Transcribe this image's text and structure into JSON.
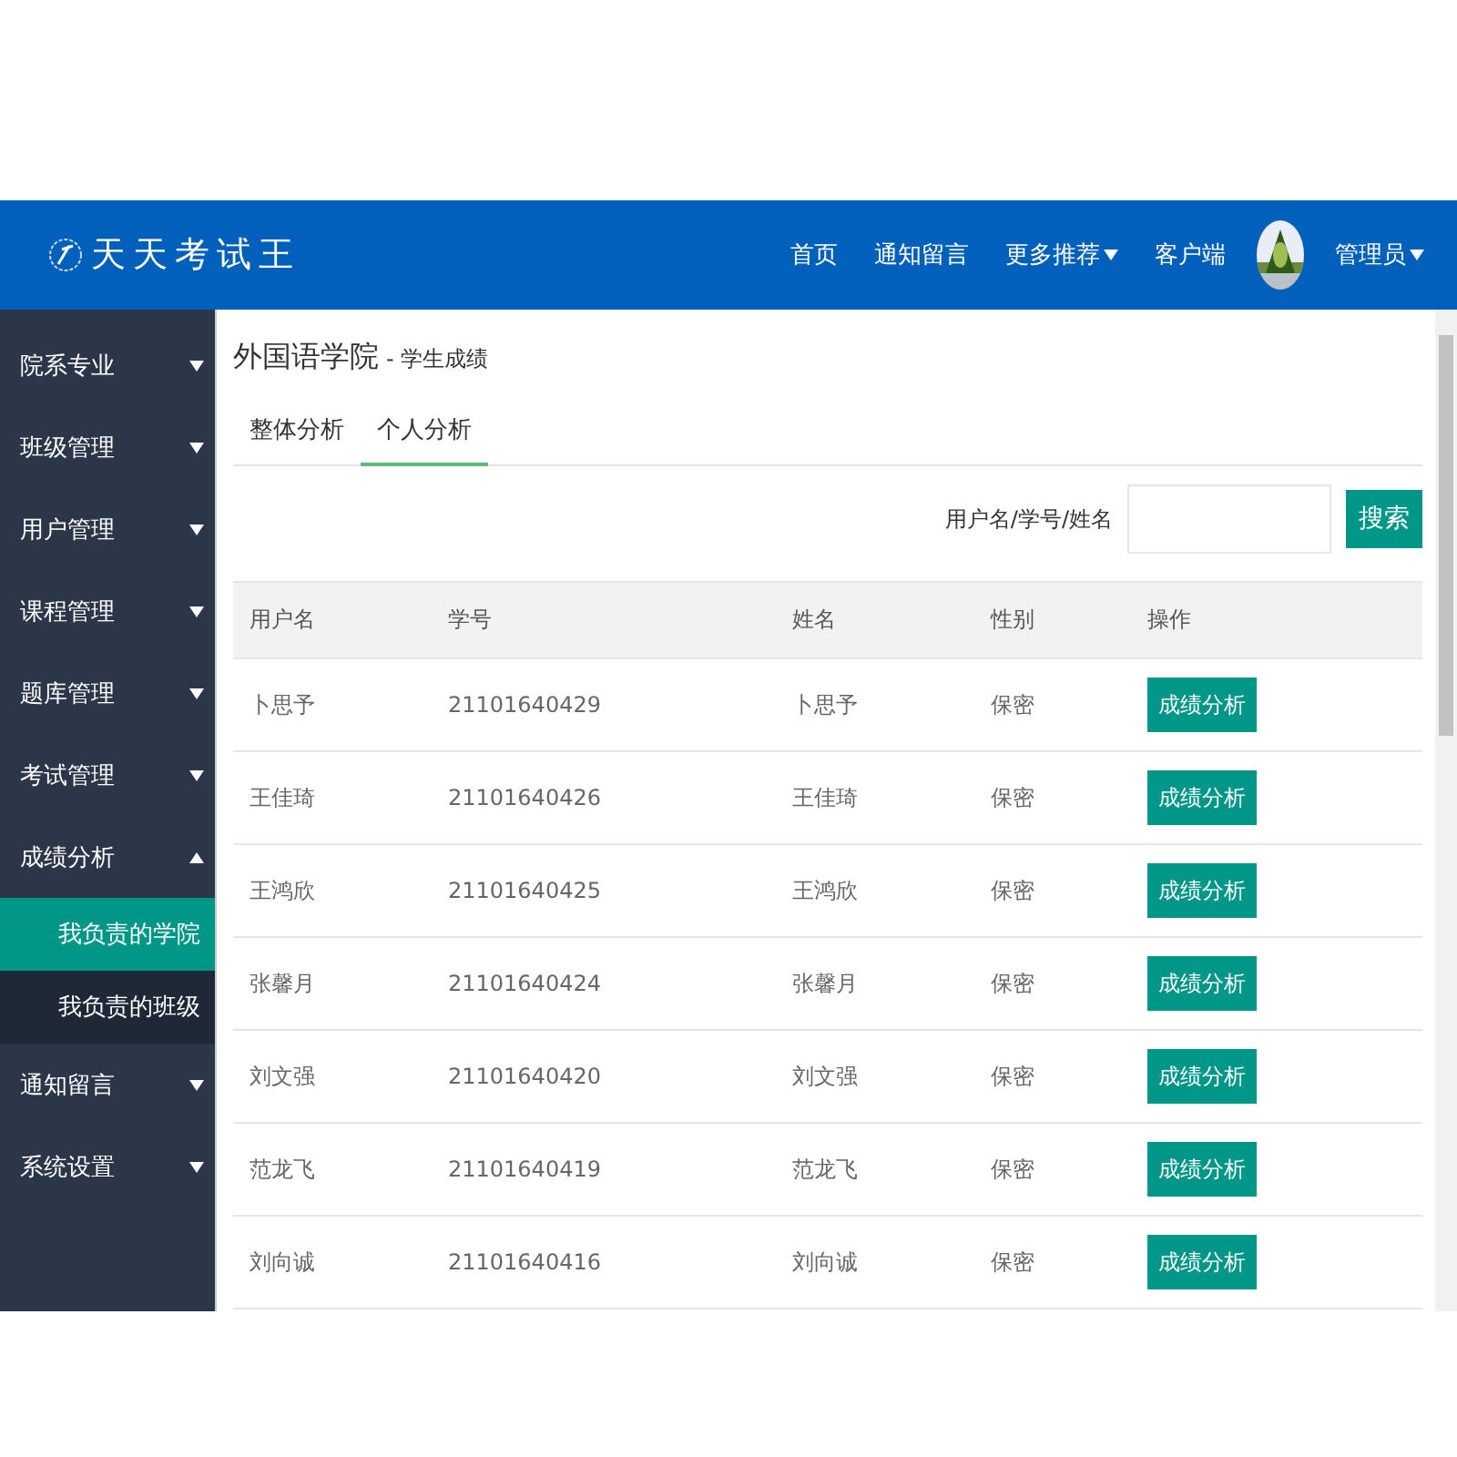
{
  "header": {
    "logo": "天天考试王",
    "nav": [
      {
        "label": "首页",
        "dropdown": false
      },
      {
        "label": "通知留言",
        "dropdown": false
      },
      {
        "label": "更多推荐",
        "dropdown": true
      },
      {
        "label": "客户端",
        "dropdown": false
      }
    ],
    "user": {
      "name": "管理员",
      "dropdown": true
    }
  },
  "sidebar": {
    "items": [
      {
        "label": "院系专业",
        "expanded": false
      },
      {
        "label": "班级管理",
        "expanded": false
      },
      {
        "label": "用户管理",
        "expanded": false
      },
      {
        "label": "课程管理",
        "expanded": false
      },
      {
        "label": "题库管理",
        "expanded": false
      },
      {
        "label": "考试管理",
        "expanded": false
      },
      {
        "label": "成绩分析",
        "expanded": true,
        "children": [
          {
            "label": "我负责的学院",
            "selected": true
          },
          {
            "label": "我负责的班级",
            "selected": false
          }
        ]
      },
      {
        "label": "通知留言",
        "expanded": false
      },
      {
        "label": "系统设置",
        "expanded": false
      }
    ]
  },
  "page": {
    "title": "外国语学院",
    "subtitle": "- 学生成绩",
    "tabs": [
      {
        "label": "整体分析",
        "selected": false
      },
      {
        "label": "个人分析",
        "selected": true
      }
    ],
    "search": {
      "label": "用户名/学号/姓名",
      "button": "搜索"
    },
    "table": {
      "columns": [
        "用户名",
        "学号",
        "姓名",
        "性别",
        "操作"
      ],
      "rows": [
        {
          "username": "卜思予",
          "id": "21101640429",
          "name": "卜思予",
          "gender": "保密",
          "action": "成绩分析"
        },
        {
          "username": "王佳琦",
          "id": "21101640426",
          "name": "王佳琦",
          "gender": "保密",
          "action": "成绩分析"
        },
        {
          "username": "王鸿欣",
          "id": "21101640425",
          "name": "王鸿欣",
          "gender": "保密",
          "action": "成绩分析"
        },
        {
          "username": "张馨月",
          "id": "21101640424",
          "name": "张馨月",
          "gender": "保密",
          "action": "成绩分析"
        },
        {
          "username": "刘文强",
          "id": "21101640420",
          "name": "刘文强",
          "gender": "保密",
          "action": "成绩分析"
        },
        {
          "username": "范龙飞",
          "id": "21101640419",
          "name": "范龙飞",
          "gender": "保密",
          "action": "成绩分析"
        },
        {
          "username": "刘向诚",
          "id": "21101640416",
          "name": "刘向诚",
          "gender": "保密",
          "action": "成绩分析"
        }
      ]
    }
  }
}
